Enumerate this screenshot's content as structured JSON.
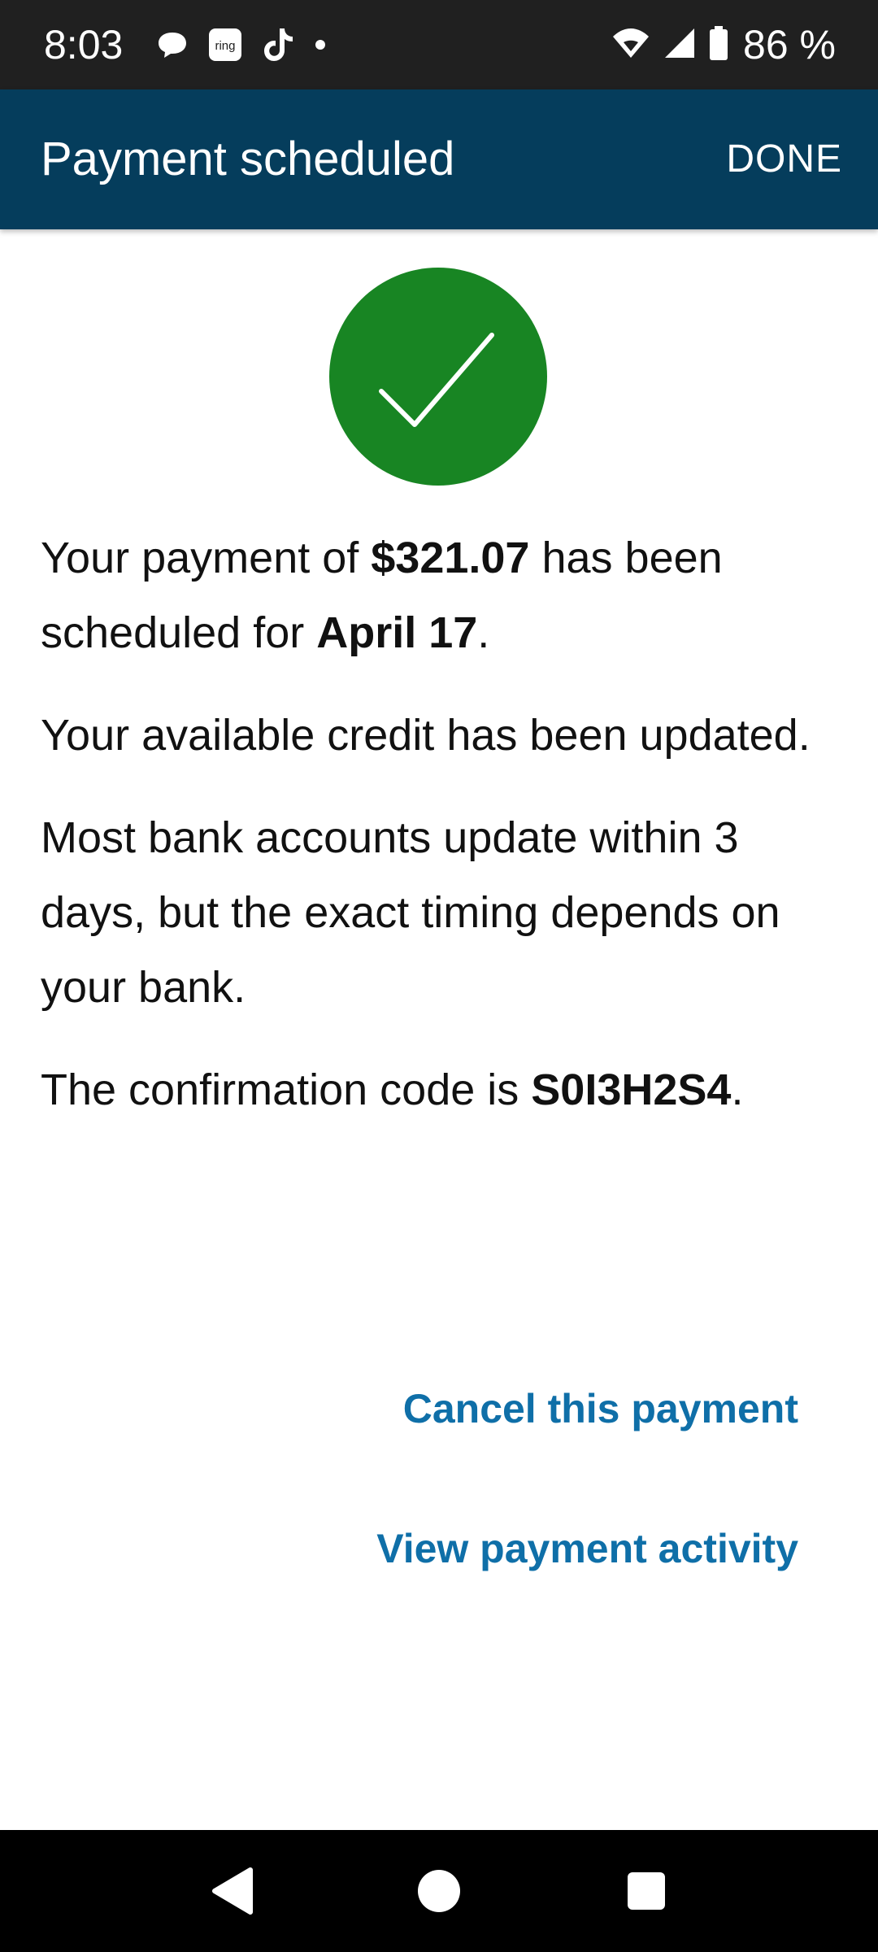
{
  "status_bar": {
    "time": "8:03",
    "notification_icons": [
      "chat-bubble-icon",
      "ring-app-icon",
      "tiktok-icon",
      "more-dot-icon"
    ],
    "ring_icon_text": "ring",
    "battery_text": "86 %"
  },
  "app_bar": {
    "title": "Payment scheduled",
    "done_label": "DONE",
    "background_color": "#053d5c"
  },
  "success": {
    "icon": "checkmark-circle-icon",
    "color": "#188523"
  },
  "messages": {
    "payment": {
      "prefix": "Your payment of ",
      "amount": "$321.07",
      "middle": " has been scheduled for ",
      "date": "April 17",
      "suffix": "."
    },
    "credit_updated": "Your available credit has been updated.",
    "bank_timing": "Most bank accounts update within 3 days, but the exact timing depends on your bank.",
    "confirmation": {
      "prefix": "The confirmation code is ",
      "code": "S0I3H2S4",
      "suffix": "."
    }
  },
  "actions": {
    "cancel_label": "Cancel this payment",
    "view_activity_label": "View payment activity",
    "link_color": "#0f6fa8"
  },
  "nav_bar": {
    "buttons": [
      "back-icon",
      "home-icon",
      "recents-icon"
    ]
  }
}
